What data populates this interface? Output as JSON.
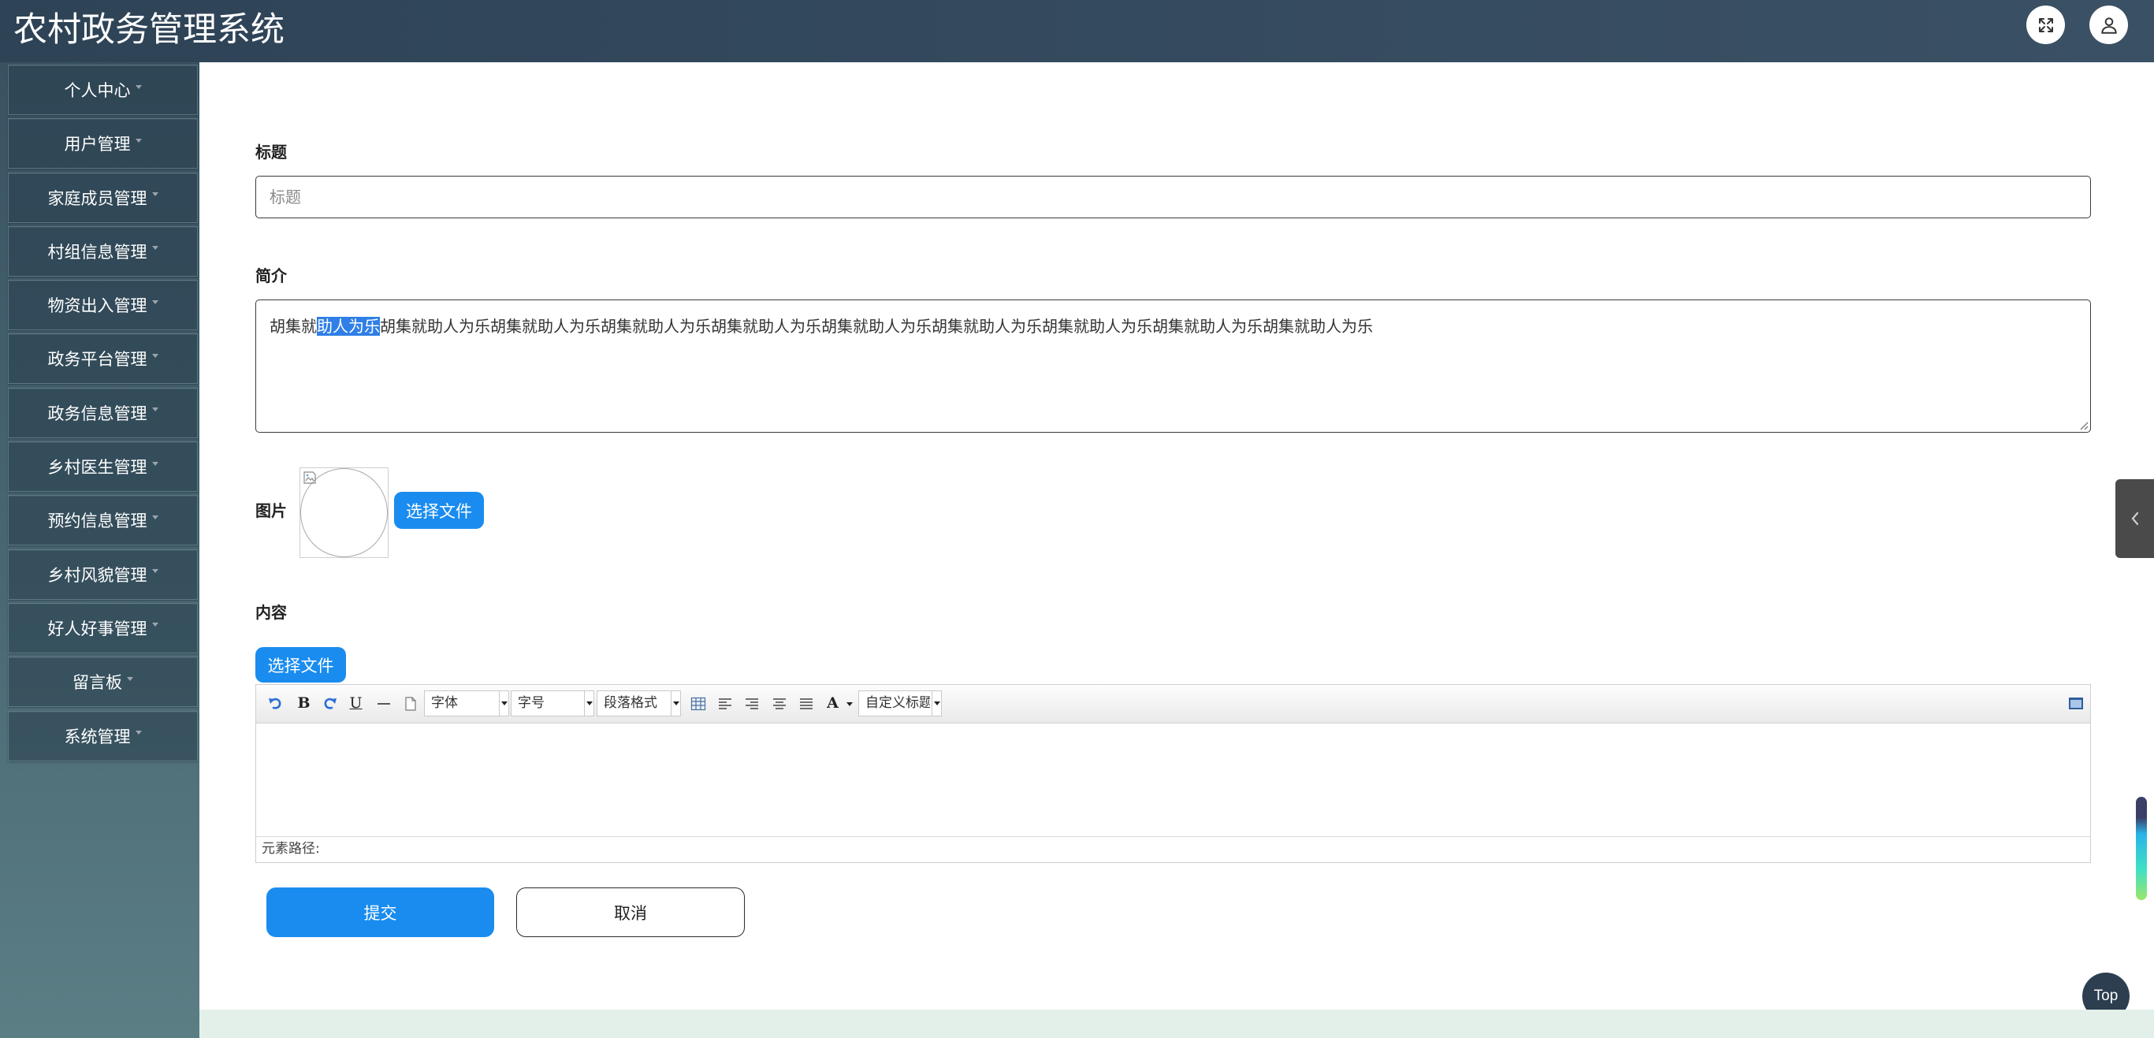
{
  "app": {
    "title": "农村政务管理系统"
  },
  "header": {
    "icons": [
      "fullscreen-icon",
      "user-icon"
    ]
  },
  "sidebar": {
    "item_icon": "chevron-down-icon",
    "items": [
      {
        "label": "个人中心"
      },
      {
        "label": "用户管理"
      },
      {
        "label": "家庭成员管理"
      },
      {
        "label": "村组信息管理"
      },
      {
        "label": "物资出入管理"
      },
      {
        "label": "政务平台管理"
      },
      {
        "label": "政务信息管理"
      },
      {
        "label": "乡村医生管理"
      },
      {
        "label": "预约信息管理"
      },
      {
        "label": "乡村风貌管理"
      },
      {
        "label": "好人好事管理"
      },
      {
        "label": "留言板"
      },
      {
        "label": "系统管理"
      }
    ]
  },
  "form": {
    "title_field": {
      "label": "标题",
      "value": "",
      "placeholder": "标题"
    },
    "intro_field": {
      "label": "简介",
      "text_before_selection": "胡集就",
      "selected_text": "助人为乐",
      "text_after_selection": "胡集就助人为乐胡集就助人为乐胡集就助人为乐胡集就助人为乐胡集就助人为乐胡集就助人为乐胡集就助人为乐胡集就助人为乐胡集就助人为乐"
    },
    "image_field": {
      "label": "图片",
      "preview_icon": "broken-image-icon",
      "upload_button": "选择文件"
    },
    "content_field": {
      "label": "内容",
      "upload_button": "选择文件",
      "editor": {
        "toolbar": {
          "icons": [
            "undo-icon",
            "bold-icon",
            "redo-icon",
            "underline-icon",
            "horizontal-rule-icon",
            "document-icon",
            "table-icon",
            "align-left-icon",
            "align-right-icon",
            "align-center-icon",
            "justify-icon",
            "font-color-icon",
            "preview-icon"
          ],
          "bold_glyph": "B",
          "underline_glyph": "U",
          "font_color_glyph": "A",
          "font_family_select": "字体",
          "font_size_select": "字号",
          "paragraph_select": "段落格式",
          "custom_heading_select": "自定义标题"
        },
        "status_label": "元素路径:"
      }
    },
    "actions": {
      "submit": "提交",
      "cancel": "取消"
    }
  },
  "floating": {
    "side_panel_icon": "chevron-left-icon",
    "back_to_top": "Top"
  },
  "colors": {
    "header_bg": "#34495c",
    "sidebar_bg": "#4a6874",
    "accent": "#1a8cef",
    "selection": "#2f7fe6",
    "back_to_top_bg": "#2c3e50",
    "footer_strip": "#e3f0e9"
  }
}
